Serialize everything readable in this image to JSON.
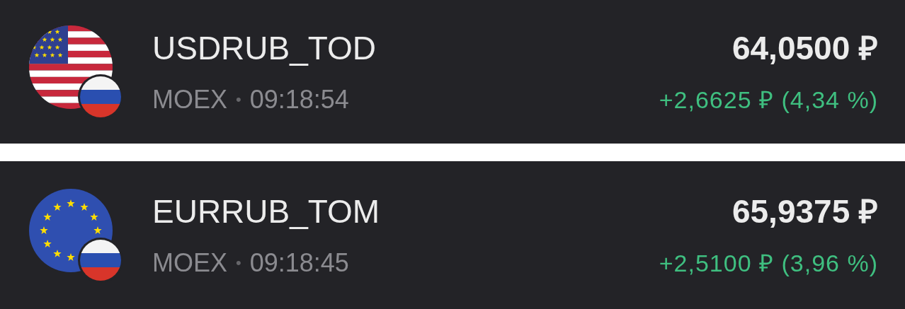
{
  "quotes": [
    {
      "kind": "us",
      "ticker": "USDRUB_TOD",
      "exchange": "MOEX",
      "separator": "•",
      "time": "09:18:54",
      "price": "64,0500 ₽",
      "change": "+2,6625 ₽ (4,34 %)"
    },
    {
      "kind": "eu",
      "ticker": "EURRUB_TOM",
      "exchange": "MOEX",
      "separator": "•",
      "time": "09:18:45",
      "price": "65,9375 ₽",
      "change": "+2,5100 ₽ (3,96 %)"
    }
  ]
}
